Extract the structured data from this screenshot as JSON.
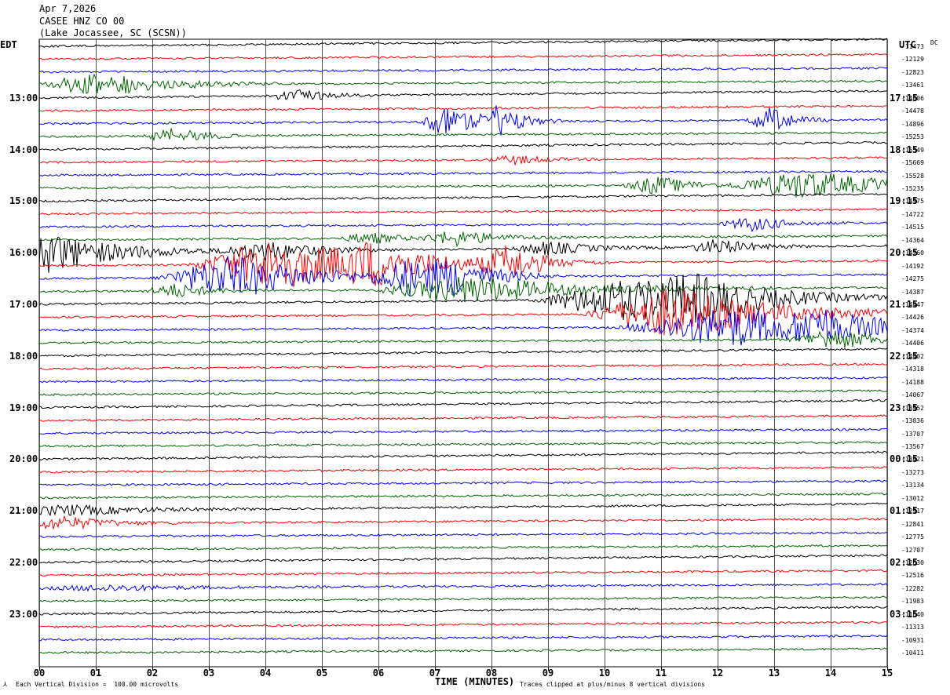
{
  "header": {
    "date": "Apr 7,2026",
    "station": "CASEE HNZ CO 00",
    "location": "(Lake Jocassee, SC (SCSN))"
  },
  "left_tz": "EDT",
  "right_tz": "UTC",
  "dc_header": "DC",
  "x_axis_title": "TIME (MINUTES)",
  "footer_scale": "Each Vertical Division =  100.00 microvolts",
  "footer_clip": "Traces clipped at plus/minus 8 vertical divisions",
  "colors": {
    "black": "#000000",
    "red": "#ff0000",
    "blue": "#0000ff",
    "green": "#006400",
    "grid": "#555555"
  },
  "chart_data": {
    "type": "line",
    "x_ticks": [
      "00",
      "01",
      "02",
      "03",
      "04",
      "05",
      "06",
      "07",
      "08",
      "09",
      "10",
      "11",
      "12",
      "13",
      "14",
      "15"
    ],
    "xlim": [
      0,
      15
    ],
    "trace_colors": [
      "black",
      "red",
      "blue",
      "green"
    ],
    "left_hour_labels": [
      "13:00",
      "14:00",
      "15:00",
      "16:00",
      "17:00",
      "18:00",
      "19:00",
      "20:00",
      "21:00",
      "22:00",
      "23:00"
    ],
    "right_hour_labels": [
      "17:15",
      "18:15",
      "19:15",
      "20:15",
      "21:15",
      "22:15",
      "23:15",
      "00:15",
      "01:15",
      "02:15",
      "03:15"
    ],
    "dc_offsets": [
      -11473,
      -12129,
      -12823,
      -13461,
      -14006,
      -14478,
      -14896,
      -15253,
      -15549,
      -15669,
      -15528,
      -15235,
      -14975,
      -14722,
      -14515,
      -14364,
      -14260,
      -14192,
      -14275,
      -14387,
      -14447,
      -14426,
      -14374,
      -14406,
      -14402,
      -14318,
      -14188,
      -14067,
      -13952,
      -13836,
      -13707,
      -13567,
      -13421,
      -13273,
      -13134,
      -13012,
      -12917,
      -12841,
      -12775,
      -12707,
      -12630,
      -12516,
      -12282,
      -11983,
      -11640,
      -11313,
      -10931,
      -10411
    ]
  }
}
